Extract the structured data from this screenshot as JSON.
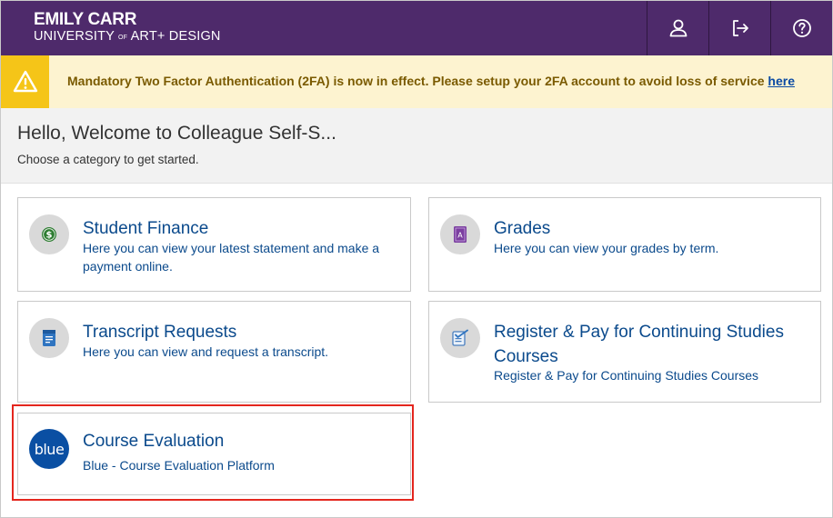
{
  "header": {
    "logo_line1": "EMILY CARR",
    "logo_line2_a": "UNIVERSITY",
    "logo_line2_of": "OF",
    "logo_line2_b": "ART+ DESIGN",
    "bg_color": "#4e2a6b",
    "buttons": [
      {
        "icon": "user-icon"
      },
      {
        "icon": "sign-out-icon"
      },
      {
        "icon": "help-icon"
      }
    ]
  },
  "alert": {
    "icon": "warning-icon",
    "message": "Mandatory Two Factor Authentication (2FA) is now in effect. Please setup your 2FA account to avoid loss of service ",
    "link_text": "here"
  },
  "welcome": {
    "title": "Hello, Welcome to Colleague Self-S...",
    "subtitle": "Choose a category to get started."
  },
  "cards": [
    {
      "title": "Student Finance",
      "description": "Here you can view your latest statement and make a payment online.",
      "icon": "dollar-icon"
    },
    {
      "title": "Grades",
      "description": "Here you can view your grades by term.",
      "icon": "grades-icon"
    },
    {
      "title": "Transcript Requests",
      "description": "Here you can view and request a transcript.",
      "icon": "transcript-icon"
    },
    {
      "title": "Register & Pay for Continuing Studies Courses",
      "description": "Register & Pay for Continuing Studies Courses",
      "icon": "checklist-icon"
    },
    {
      "title": "Course Evaluation",
      "description": "Blue - Course Evaluation Platform",
      "icon": "blue-logo-icon",
      "logo_text": "blue"
    }
  ],
  "colors": {
    "accent_link": "#0b4a8c",
    "alert_bg": "#fdf3d0",
    "alert_icon_bg": "#f5c518",
    "highlight": "#e4261e"
  }
}
